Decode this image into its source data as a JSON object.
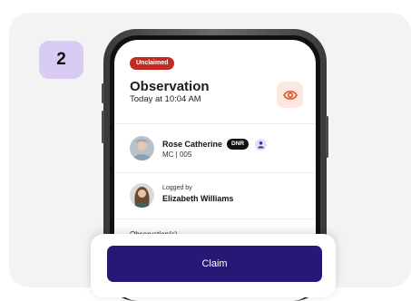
{
  "step": {
    "number": "2"
  },
  "alert": {
    "status_badge": "Unclaimed",
    "title": "Observation",
    "time": "Today at 10:04 AM"
  },
  "resident": {
    "name": "Rose Catherine",
    "tag": "DNR",
    "room": "MC | 005"
  },
  "logger": {
    "label": "Logged by",
    "name": "Elizabeth Williams"
  },
  "section": {
    "observations_label": "Observation(s)"
  },
  "actions": {
    "claim_label": "Claim"
  },
  "icons": {
    "view": "eye-icon",
    "care_team": "person-badge-icon"
  },
  "colors": {
    "accent": "#281774",
    "badge_red": "#c52a21",
    "step_bg": "#d8ccf5",
    "eye_bg": "#fde8df",
    "eye_stroke": "#e0502a"
  }
}
